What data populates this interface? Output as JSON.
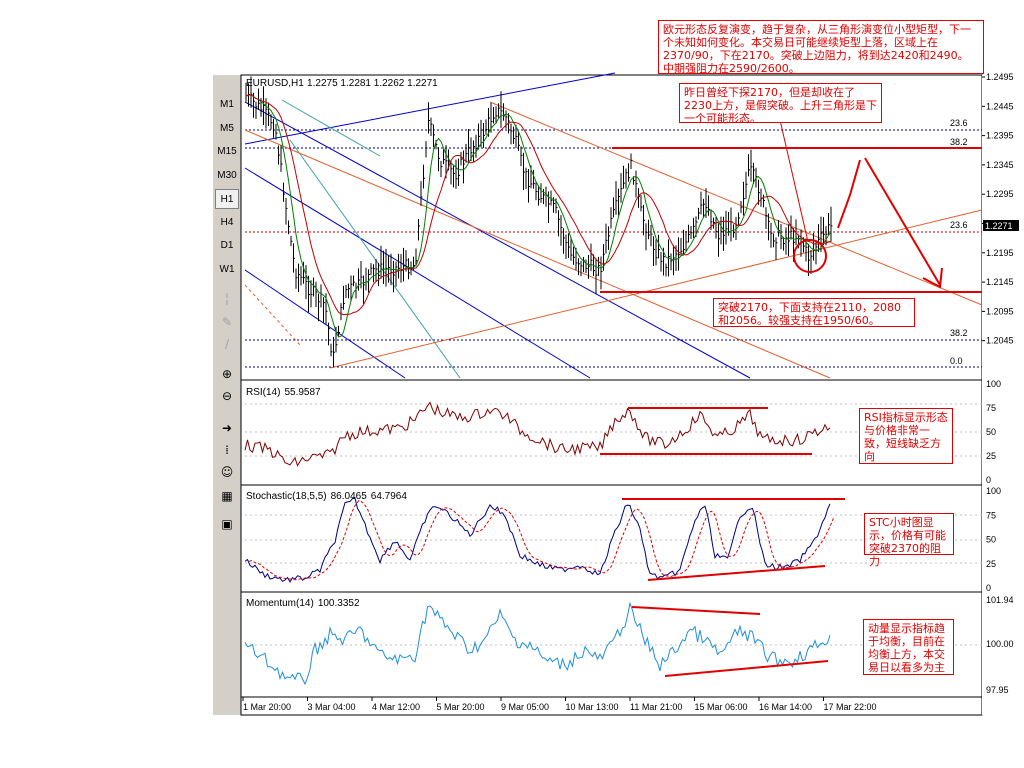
{
  "header": {
    "symbol_label": "EURUSD,H1",
    "ohlc": "1.2275 1.2281 1.2262 1.2271"
  },
  "timeframes": [
    "M1",
    "M5",
    "M15",
    "M30",
    "H1",
    "H4",
    "D1",
    "W1"
  ],
  "active_timeframe": "H1",
  "tools": [
    {
      "name": "line-tool-icon",
      "glyph": "╎",
      "dim": true
    },
    {
      "name": "pencil-tool-icon",
      "glyph": "✎",
      "dim": true
    },
    {
      "name": "trend-tool-icon",
      "glyph": "∕",
      "dim": true
    },
    {
      "name": "zoom-in-icon",
      "glyph": "⊕",
      "dim": false
    },
    {
      "name": "zoom-out-icon",
      "glyph": "⊖",
      "dim": false
    },
    {
      "name": "chart-shift-icon",
      "glyph": "➜",
      "dim": false
    },
    {
      "name": "indicator-list-icon",
      "glyph": "⁞",
      "dim": false
    },
    {
      "name": "expert-icon",
      "glyph": "☺",
      "dim": false
    },
    {
      "name": "template-icon",
      "glyph": "▦",
      "dim": false
    },
    {
      "name": "profile-icon",
      "glyph": "▣",
      "dim": false
    }
  ],
  "price_axis": {
    "labels": [
      "1.2495",
      "1.2445",
      "1.2395",
      "1.2345",
      "1.2295",
      "1.2245",
      "1.2195",
      "1.2145",
      "1.2095",
      "1.2045"
    ],
    "current_price": "1.2271"
  },
  "time_axis": [
    "1 Mar 20:00",
    "3 Mar 04:00",
    "4 Mar 12:00",
    "5 Mar 20:00",
    "9 Mar 05:00",
    "10 Mar 13:00",
    "11 Mar 21:00",
    "15 Mar 06:00",
    "16 Mar 14:00",
    "17 Mar 22:00"
  ],
  "fibonacci": [
    "23.6",
    "38.2",
    "23.6",
    "38.2",
    "0.0"
  ],
  "rsi": {
    "label": "RSI(14)",
    "value": "55.9587",
    "axis": [
      "100",
      "75",
      "50",
      "25",
      "0"
    ]
  },
  "stochastic": {
    "label": "Stochastic(18,5,5)",
    "value1": "86.0465",
    "value2": "64.7964",
    "axis": [
      "100",
      "75",
      "50",
      "25",
      "0"
    ]
  },
  "momentum": {
    "label": "Momentum(14)",
    "value": "100.3352",
    "axis": [
      "101.94",
      "100.00",
      "97.95"
    ]
  },
  "notes": {
    "top": "欧元形态反复演变，趋于复杂，从三角形演变位小型矩型，下一个未知如何变化。本交易日可能继续矩型上落，区域上在2370/90，下在2170。突破上边阻力，将到达2420和2490。中期强阻力在2590/2600。",
    "second": "昨日曾经下探2170，但是却收在了2230上方，是假突破。上升三角形是下一个可能形态。",
    "support": "突破2170，下面支持在2110，2080和2056。较强支持在1950/60。",
    "rsi": "RSI指标显示形态与价格非常一致，短线缺乏方向",
    "stc": "STC小时图显示，价格有可能突破2370的阻力",
    "momentum": "动量显示指标趋于均衡，目前在均衡上方，本交易日以看多为主"
  },
  "colors": {
    "bar": "#000000",
    "ma_red": "#c00000",
    "ma_green": "#008000",
    "channel_blue": "#0000cc",
    "channel_orange": "#e06030",
    "annotation_red": "#e00000",
    "indicator_blue": "#1e8fd8",
    "osc_dark": "#000080"
  }
}
